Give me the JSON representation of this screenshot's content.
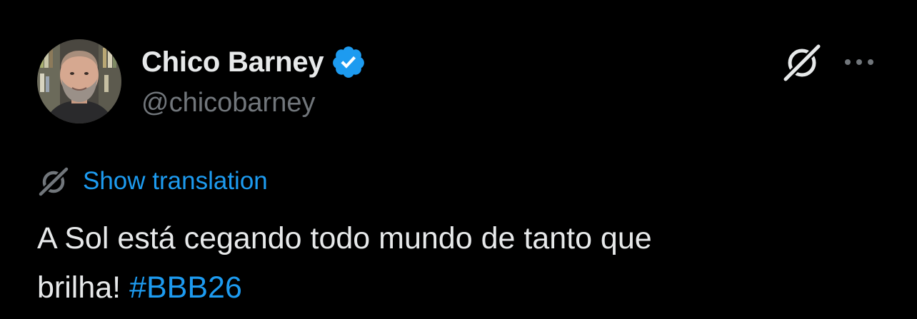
{
  "author": {
    "display_name": "Chico Barney",
    "handle": "@chicobarney",
    "verified": true,
    "avatar_icon": "profile-photo"
  },
  "actions": {
    "grok_icon": "grok-icon",
    "more_icon": "more-options-icon"
  },
  "translation": {
    "label": "Show translation",
    "icon": "grok-icon"
  },
  "tweet": {
    "line1": "A Sol está cegando todo mundo de tanto que",
    "line2": "brilha!",
    "hashtag": "#BBB26"
  },
  "colors": {
    "background": "#000000",
    "text_primary": "#e7e9ea",
    "text_secondary": "#71767b",
    "accent": "#1d9bf0"
  }
}
